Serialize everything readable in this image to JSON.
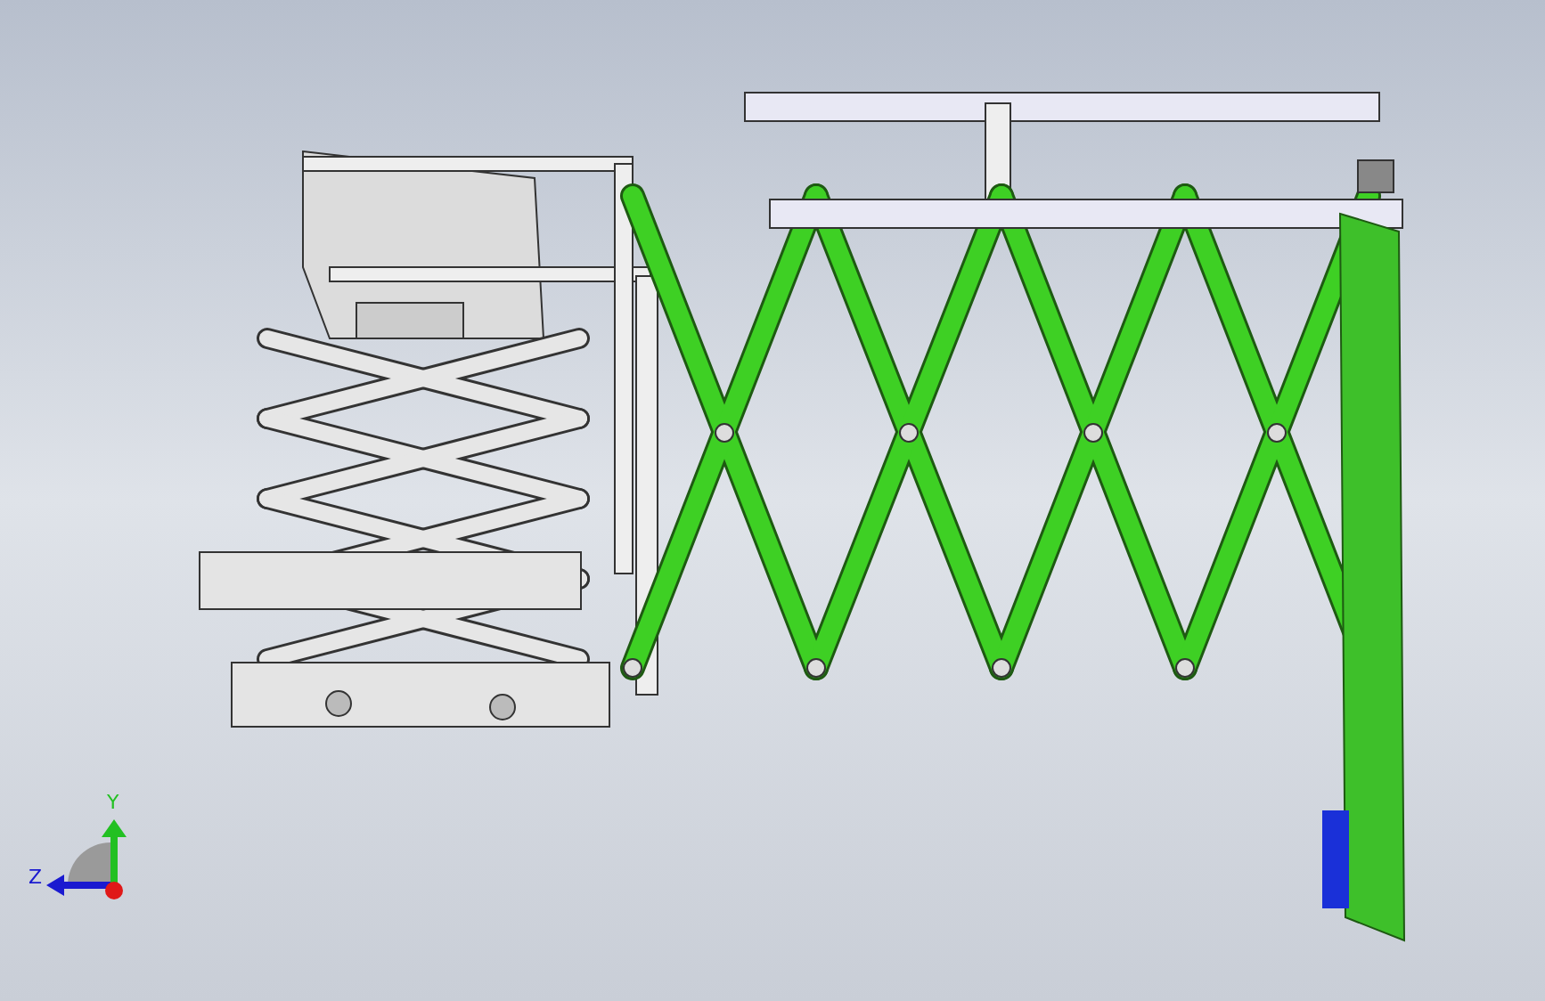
{
  "viewport": {
    "triad": {
      "axes": [
        {
          "label": "Y",
          "kind": "vertical",
          "color": "#22c022"
        },
        {
          "label": "Z",
          "kind": "horizontal",
          "color": "#1a1ad0"
        }
      ]
    }
  }
}
